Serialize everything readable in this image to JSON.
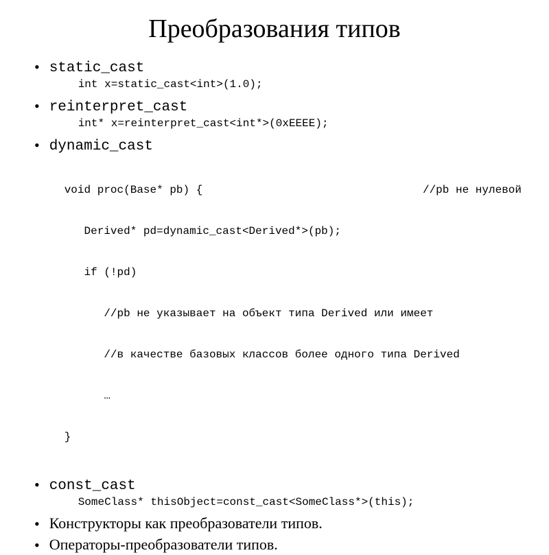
{
  "title": "Преобразования типов",
  "items": [
    {
      "label": "static_cast",
      "code": "int x=static_cast<int>(1.0);"
    },
    {
      "label": "reinterpret_cast",
      "code": "int* x=reinterpret_cast<int*>(0xEEEE);"
    },
    {
      "label": "dynamic_cast",
      "code_lines": {
        "l0_left": "void proc(Base* pb) {",
        "l0_right": "//pb не нулевой",
        "l1": "   Derived* pd=dynamic_cast<Derived*>(pb);",
        "l2": "   if (!pd)",
        "l3": "      //pb не указывает на объект типа Derived или имеет",
        "l4": "      //в качестве базовых классов более одного типа Derived",
        "l5": "      …",
        "l6": "}"
      }
    },
    {
      "label": "const_cast",
      "code": "SomeClass* thisObject=const_cast<SomeClass*>(this);"
    },
    {
      "label": "Конструкторы как преобразователи типов."
    },
    {
      "label": "Операторы-преобразователи типов."
    }
  ]
}
